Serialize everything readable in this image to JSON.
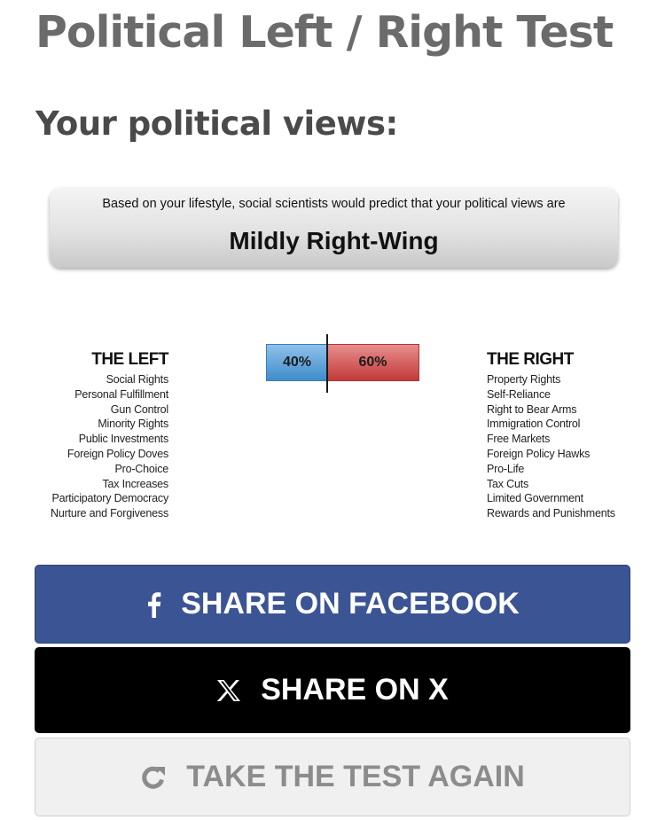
{
  "header": {
    "title": "Political Left / Right Test",
    "subtitle": "Your political views:"
  },
  "result": {
    "intro": "Based on your lifestyle, social scientists would predict that your political views are",
    "label": "Mildly Right-Wing"
  },
  "meter": {
    "left_percent": "40%",
    "right_percent": "60%",
    "left_value": 0.4,
    "right_value": 0.6,
    "left_color": "#4a90d0",
    "right_color": "#cd4545"
  },
  "left_column": {
    "heading": "THE LEFT",
    "items": [
      "Social Rights",
      "Personal Fulfillment",
      "Gun Control",
      "Minority Rights",
      "Public Investments",
      "Foreign Policy Doves",
      "Pro-Choice",
      "Tax Increases",
      "Participatory Democracy",
      "Nurture and Forgiveness"
    ]
  },
  "right_column": {
    "heading": "THE RIGHT",
    "items": [
      "Property Rights",
      "Self-Reliance",
      "Right to Bear Arms",
      "Immigration Control",
      "Free Markets",
      "Foreign Policy Hawks",
      "Pro-Life",
      "Tax Cuts",
      "Limited Government",
      "Rewards and Punishments"
    ]
  },
  "buttons": {
    "facebook": {
      "label": "SHARE ON FACEBOOK",
      "icon": "facebook-icon",
      "color": "#3b5493"
    },
    "x": {
      "label": "SHARE ON X",
      "icon": "x-logo-icon",
      "color": "#000000"
    },
    "retake": {
      "label": "TAKE THE TEST AGAIN",
      "icon": "refresh-icon",
      "color": "#f0f0f0"
    }
  }
}
